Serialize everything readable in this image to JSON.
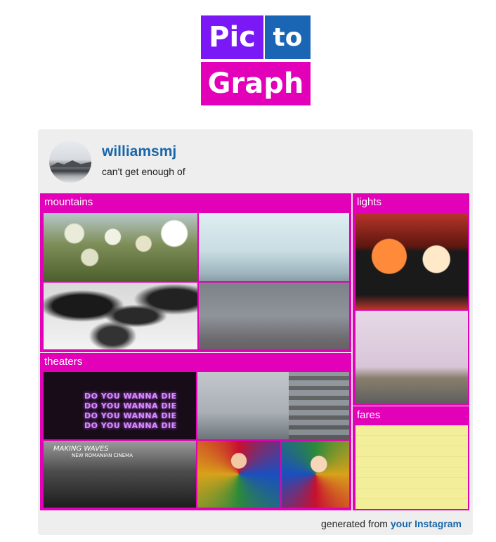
{
  "logo": {
    "word1": "Pic",
    "word2": "to",
    "word3": "Graph",
    "colors": {
      "pic": "#7a19f5",
      "to": "#1a66b4",
      "graph": "#e200b8"
    }
  },
  "profile": {
    "username": "williamsmj",
    "tagline": "can't get enough of"
  },
  "sections": [
    {
      "label": "mountains",
      "photos": [
        "flowering-shrub",
        "pale-sky",
        "black-white-texture",
        "foggy-plain"
      ]
    },
    {
      "label": "lights",
      "photos": [
        "walk-signal",
        "railroad-crossing"
      ]
    },
    {
      "label": "theaters",
      "photos": [
        "neon-sign",
        "scaffolding-building",
        "cinema-screen",
        "stained-glass-1",
        "stained-glass-2"
      ]
    },
    {
      "label": "fares",
      "photos": [
        "fare-list"
      ]
    }
  ],
  "photo_text": {
    "neon_sign": [
      "DO YOU WANNA DIE",
      "DO YOU WANNA DIE",
      "DO YOU WANNA DIE",
      "DO YOU WANNA DIE"
    ],
    "cinema_title": "MAKING WAVES",
    "cinema_subtitle": "NEW ROMANIAN CINEMA"
  },
  "footer": {
    "prefix": "generated from ",
    "link": "your Instagram"
  },
  "accent_color": "#e200b8",
  "link_color": "#1a66a8"
}
